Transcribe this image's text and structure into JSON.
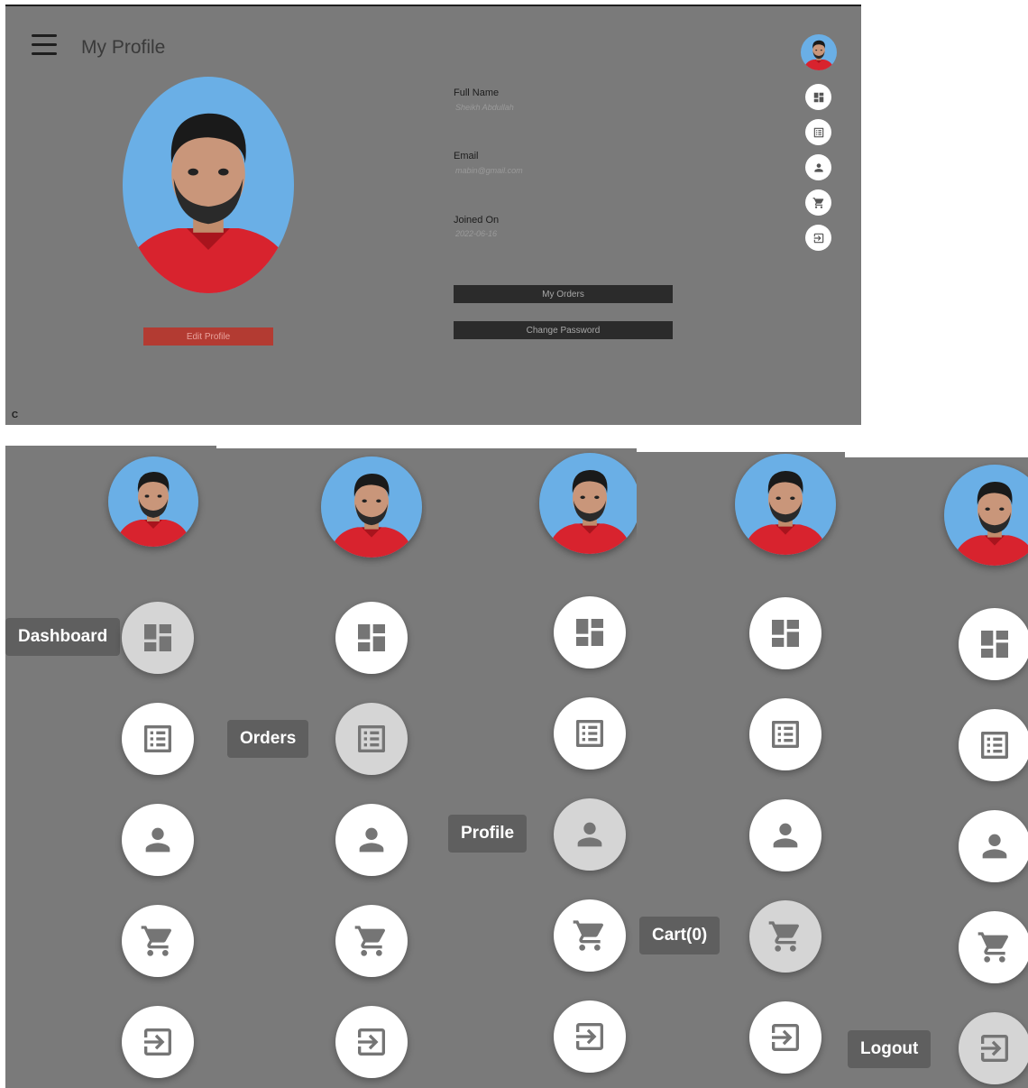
{
  "header": {
    "title": "My Profile"
  },
  "profile": {
    "edit_label": "Edit Profile",
    "fields": [
      {
        "label": "Full Name",
        "value": "Sheikh Abdullah"
      },
      {
        "label": "Email",
        "value": "mabin@gmail.com"
      },
      {
        "label": "Joined On",
        "value": "2022-06-16"
      }
    ],
    "buttons": {
      "orders": "My Orders",
      "password": "Change Password"
    }
  },
  "corner_badge": "C",
  "speed_dial": {
    "items": [
      {
        "label": "Dashboard",
        "icon": "dashboard-icon"
      },
      {
        "label": "Orders",
        "icon": "list-icon"
      },
      {
        "label": "Profile",
        "icon": "person-icon"
      },
      {
        "label": "Cart(0)",
        "icon": "cart-icon"
      },
      {
        "label": "Logout",
        "icon": "logout-icon"
      }
    ]
  },
  "colors": {
    "background": "#7a7a7a",
    "accent_red": "#b33b32",
    "dark_button": "#2b2b2b",
    "avatar_bg": "#6aafe6"
  }
}
